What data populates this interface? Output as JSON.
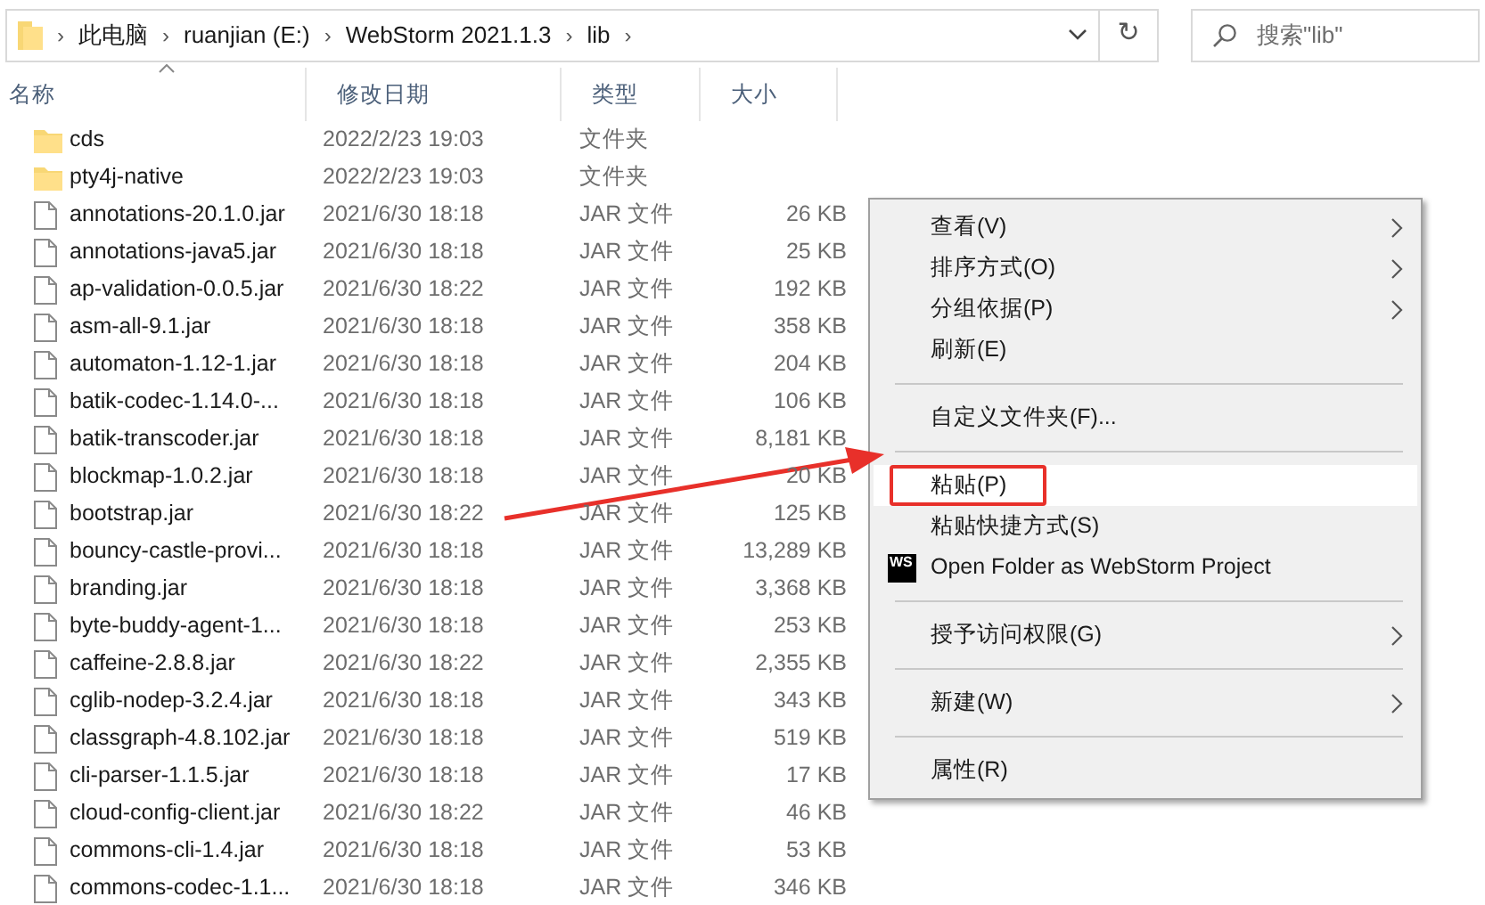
{
  "address_bar": {
    "breadcrumbs": [
      "此电脑",
      "ruanjian (E:)",
      "WebStorm 2021.1.3",
      "lib"
    ],
    "refresh": "↻",
    "separator": "›"
  },
  "search": {
    "placeholder": "搜索\"lib\""
  },
  "columns": [
    {
      "label": "名称",
      "sorted": true
    },
    {
      "label": "修改日期",
      "sorted": false
    },
    {
      "label": "类型",
      "sorted": false
    },
    {
      "label": "大小",
      "sorted": false
    }
  ],
  "files": [
    {
      "kind": "folder",
      "name": "cds",
      "modified": "2022/2/23 19:03",
      "type": "文件夹"
    },
    {
      "kind": "folder",
      "name": "pty4j-native",
      "modified": "2022/2/23 19:03",
      "type": "文件夹"
    },
    {
      "kind": "file",
      "name": "annotations-20.1.0.jar",
      "modified": "2021/6/30 18:18",
      "type": "JAR 文件",
      "size": "26 KB"
    },
    {
      "kind": "file",
      "name": "annotations-java5.jar",
      "modified": "2021/6/30 18:18",
      "type": "JAR 文件",
      "size": "25 KB"
    },
    {
      "kind": "file",
      "name": "ap-validation-0.0.5.jar",
      "modified": "2021/6/30 18:22",
      "type": "JAR 文件",
      "size": "192 KB"
    },
    {
      "kind": "file",
      "name": "asm-all-9.1.jar",
      "modified": "2021/6/30 18:18",
      "type": "JAR 文件",
      "size": "358 KB"
    },
    {
      "kind": "file",
      "name": "automaton-1.12-1.jar",
      "modified": "2021/6/30 18:18",
      "type": "JAR 文件",
      "size": "204 KB"
    },
    {
      "kind": "file",
      "name": "batik-codec-1.14.0-...",
      "modified": "2021/6/30 18:18",
      "type": "JAR 文件",
      "size": "106 KB"
    },
    {
      "kind": "file",
      "name": "batik-transcoder.jar",
      "modified": "2021/6/30 18:18",
      "type": "JAR 文件",
      "size": "8,181 KB"
    },
    {
      "kind": "file",
      "name": "blockmap-1.0.2.jar",
      "modified": "2021/6/30 18:18",
      "type": "JAR 文件",
      "size": "20 KB"
    },
    {
      "kind": "file",
      "name": "bootstrap.jar",
      "modified": "2021/6/30 18:22",
      "type": "JAR 文件",
      "size": "125 KB"
    },
    {
      "kind": "file",
      "name": "bouncy-castle-provi...",
      "modified": "2021/6/30 18:18",
      "type": "JAR 文件",
      "size": "13,289 KB"
    },
    {
      "kind": "file",
      "name": "branding.jar",
      "modified": "2021/6/30 18:18",
      "type": "JAR 文件",
      "size": "3,368 KB"
    },
    {
      "kind": "file",
      "name": "byte-buddy-agent-1...",
      "modified": "2021/6/30 18:18",
      "type": "JAR 文件",
      "size": "253 KB"
    },
    {
      "kind": "file",
      "name": "caffeine-2.8.8.jar",
      "modified": "2021/6/30 18:22",
      "type": "JAR 文件",
      "size": "2,355 KB"
    },
    {
      "kind": "file",
      "name": "cglib-nodep-3.2.4.jar",
      "modified": "2021/6/30 18:18",
      "type": "JAR 文件",
      "size": "343 KB"
    },
    {
      "kind": "file",
      "name": "classgraph-4.8.102.jar",
      "modified": "2021/6/30 18:18",
      "type": "JAR 文件",
      "size": "519 KB"
    },
    {
      "kind": "file",
      "name": "cli-parser-1.1.5.jar",
      "modified": "2021/6/30 18:18",
      "type": "JAR 文件",
      "size": "17 KB"
    },
    {
      "kind": "file",
      "name": "cloud-config-client.jar",
      "modified": "2021/6/30 18:22",
      "type": "JAR 文件",
      "size": "46 KB"
    },
    {
      "kind": "file",
      "name": "commons-cli-1.4.jar",
      "modified": "2021/6/30 18:18",
      "type": "JAR 文件",
      "size": "53 KB"
    },
    {
      "kind": "file",
      "name": "commons-codec-1.1...",
      "modified": "2021/6/30 18:18",
      "type": "JAR 文件",
      "size": "346 KB"
    }
  ],
  "context_menu": [
    {
      "kind": "item",
      "label": "查看(V)",
      "submenu": true,
      "selected": false
    },
    {
      "kind": "item",
      "label": "排序方式(O)",
      "submenu": true,
      "selected": false
    },
    {
      "kind": "item",
      "label": "分组依据(P)",
      "submenu": true,
      "selected": false
    },
    {
      "kind": "item",
      "label": "刷新(E)",
      "submenu": false,
      "selected": false
    },
    {
      "kind": "separator"
    },
    {
      "kind": "item",
      "label": "自定义文件夹(F)...",
      "submenu": false,
      "selected": false
    },
    {
      "kind": "separator"
    },
    {
      "kind": "item",
      "label": "粘贴(P)",
      "submenu": false,
      "selected": true,
      "annotated": true
    },
    {
      "kind": "item",
      "label": "粘贴快捷方式(S)",
      "submenu": false,
      "selected": false
    },
    {
      "kind": "app-item",
      "label": "Open Folder as WebStorm Project",
      "icon_text": "WS",
      "submenu": false,
      "selected": false
    },
    {
      "kind": "separator"
    },
    {
      "kind": "item",
      "label": "授予访问权限(G)",
      "submenu": true,
      "selected": false
    },
    {
      "kind": "separator"
    },
    {
      "kind": "item",
      "label": "新建(W)",
      "submenu": true,
      "selected": false
    },
    {
      "kind": "separator"
    },
    {
      "kind": "item",
      "label": "属性(R)",
      "submenu": false,
      "selected": false
    }
  ],
  "callout_arrow": true
}
